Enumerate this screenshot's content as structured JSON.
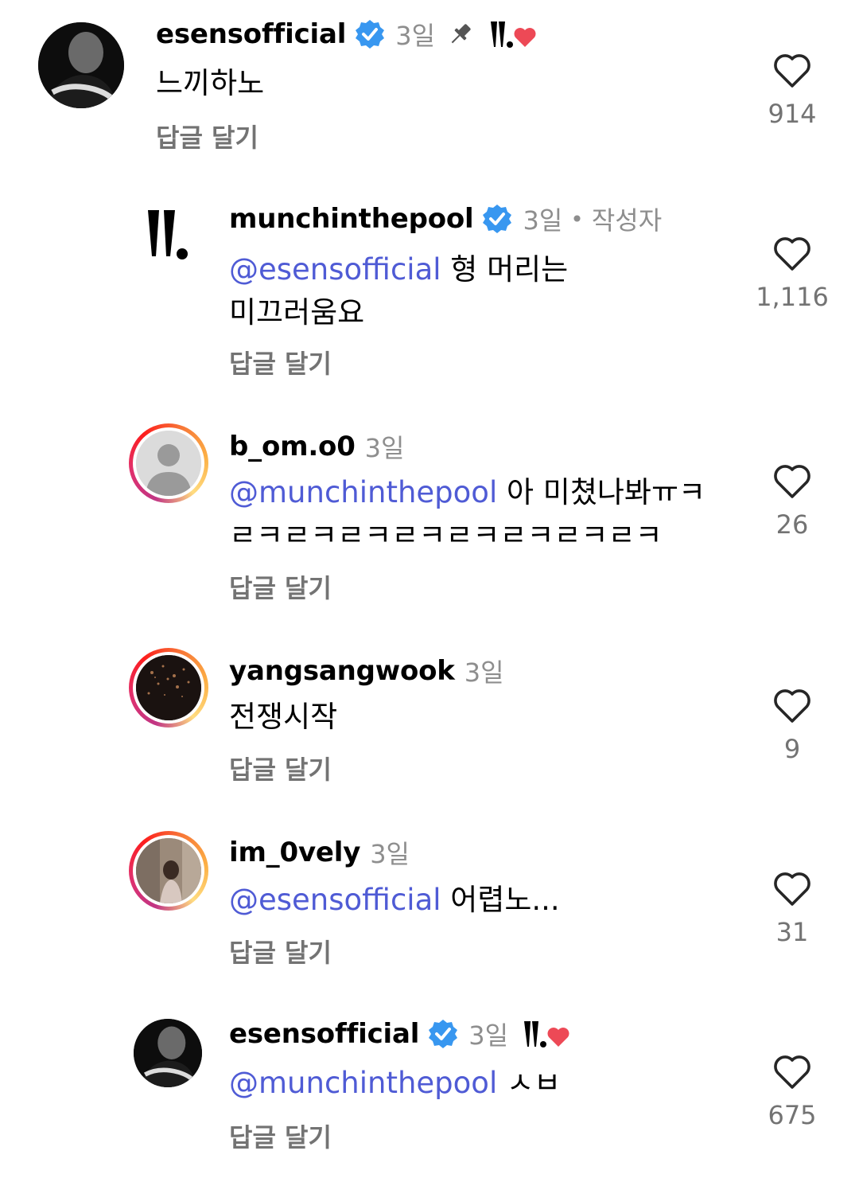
{
  "reply_label": "답글 달기",
  "comments": [
    {
      "username": "esensofficial",
      "time": "3일",
      "body": "느끼하노",
      "likes": "914",
      "verified": true,
      "pinned": true,
      "liked_by_author": true
    },
    {
      "username": "munchinthepool",
      "time": "3일",
      "author_label": "작성자",
      "mention": "@esensofficial",
      "body": "형 머리는 미끄러움요",
      "likes": "1,116",
      "verified": true
    },
    {
      "username": "b_om.o0",
      "time": "3일",
      "mention": "@munchinthepool",
      "body": "아 미쳤나봐ㅠㅋㄹㅋㄹㅋㄹㅋㄹㅋㄹㅋㄹㅋㄹㅋㄹㅋ",
      "likes": "26"
    },
    {
      "username": "yangsangwook",
      "time": "3일",
      "body": "전쟁시작",
      "likes": "9"
    },
    {
      "username": "im_0vely",
      "time": "3일",
      "mention": "@esensofficial",
      "body": "어렵노...",
      "likes": "31"
    },
    {
      "username": "esensofficial",
      "time": "3일",
      "mention": "@munchinthepool",
      "body": "ㅅㅂ",
      "likes": "675",
      "verified": true,
      "liked_by_author": true
    }
  ],
  "colors": {
    "mention": "#4f5bd5",
    "verified": "#3897f0",
    "heart_red": "#ed4956",
    "muted": "#8e8e8e"
  }
}
